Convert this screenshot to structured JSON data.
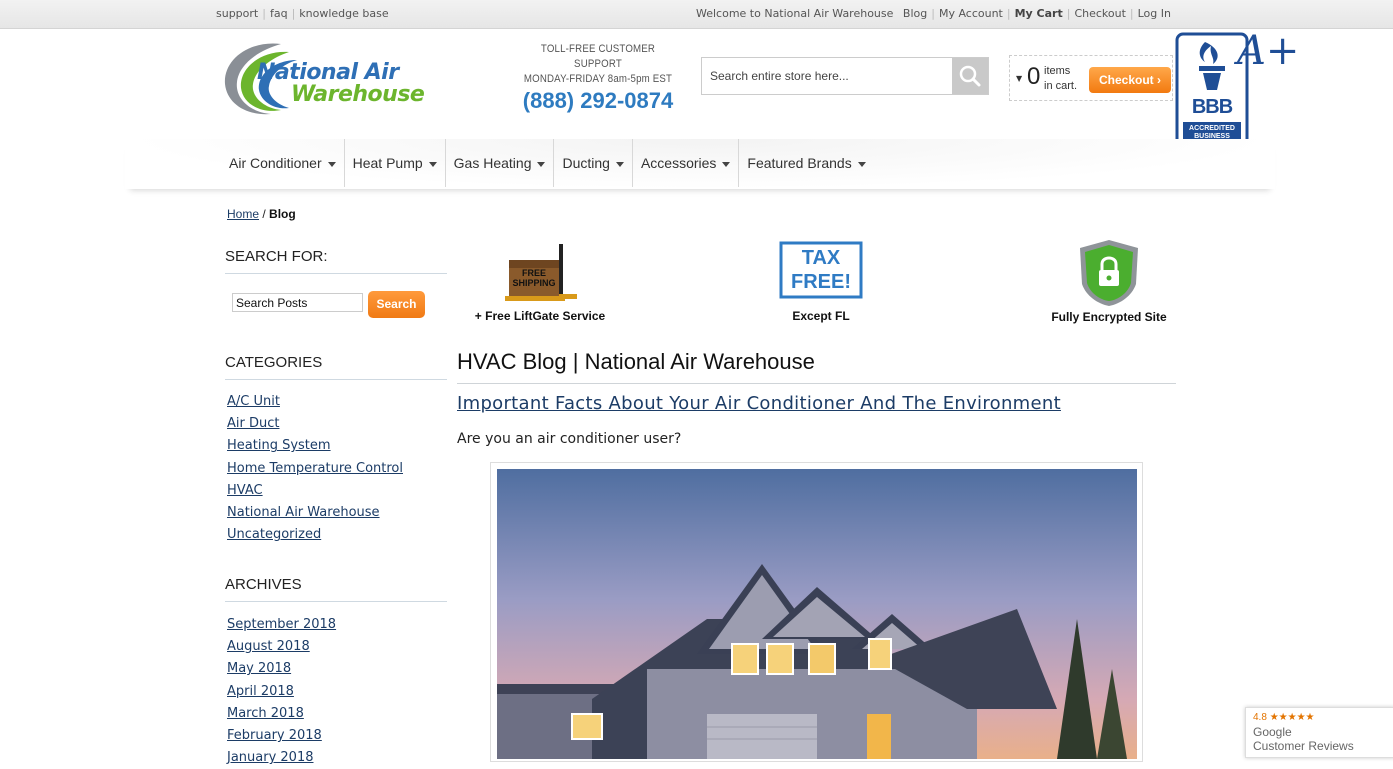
{
  "topbar": {
    "left_links": [
      "support",
      "faq",
      "knowledge base"
    ],
    "welcome": "Welcome to National Air Warehouse",
    "right_links": [
      "Blog",
      "My Account",
      "My Cart",
      "Checkout",
      "Log In"
    ]
  },
  "logo": {
    "line1": "National Air",
    "line2": "Warehouse"
  },
  "support": {
    "line1": "TOLL-FREE CUSTOMER SUPPORT",
    "line2": "MONDAY-FRIDAY 8am-5pm EST",
    "phone": "(888) 292-0874"
  },
  "search": {
    "placeholder": "Search entire store here..."
  },
  "cart": {
    "count": "0",
    "label_line1": "items",
    "label_line2": "in cart.",
    "checkout_label": "Checkout"
  },
  "bbb": {
    "letters": "BBB",
    "line1": "ACCREDITED",
    "line2": "BUSINESS",
    "grade": "A+"
  },
  "nav": {
    "items": [
      "Air Conditioner",
      "Heat Pump",
      "Gas Heating",
      "Ducting",
      "Accessories",
      "Featured Brands"
    ]
  },
  "breadcrumb": {
    "home": "Home",
    "sep": "/",
    "current": "Blog"
  },
  "sidebar": {
    "search_heading": "SEARCH FOR:",
    "search_placeholder": "Search Posts",
    "search_button": "Search",
    "categories_heading": "CATEGORIES",
    "categories": [
      "A/C Unit",
      "Air Duct",
      "Heating System",
      "Home Temperature Control",
      "HVAC",
      "National Air Warehouse",
      "Uncategorized"
    ],
    "archives_heading": "ARCHIVES",
    "archives": [
      "September 2018",
      "August 2018",
      "May 2018",
      "April 2018",
      "March 2018",
      "February 2018",
      "January 2018"
    ]
  },
  "badges": [
    {
      "image_text": "FREE SHIPPING",
      "caption": "+ Free LiftGate Service"
    },
    {
      "image_text_1": "TAX",
      "image_text_2": "FREE!",
      "caption": "Except FL"
    },
    {
      "caption": "Fully Encrypted Site"
    }
  ],
  "main": {
    "title": "HVAC Blog | National Air Warehouse",
    "post_title": "Important Facts About Your Air Conditioner And The Environment",
    "post_text": "Are you an air conditioner user?"
  },
  "google_reviews": {
    "rating": "4.8",
    "line1": "Google",
    "line2": "Customer Reviews"
  },
  "colors": {
    "accent_blue": "#2e7bc0",
    "link": "#1c3c66",
    "orange": "#f27a10",
    "green": "#6cb52d"
  }
}
